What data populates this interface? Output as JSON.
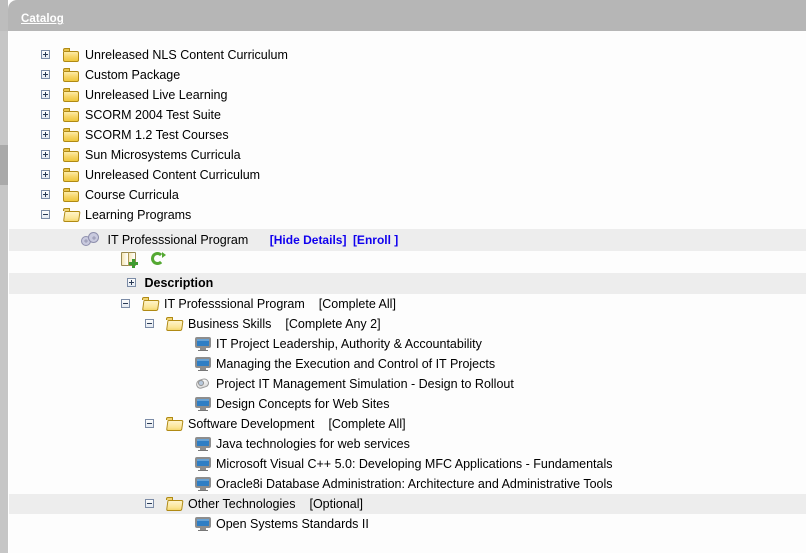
{
  "header": {
    "breadcrumb": "Catalog",
    "bar_color": "#b6b6b6"
  },
  "colors": {
    "link": "#1000ee",
    "band": "#ededed",
    "header": "#b6b6b6",
    "folder": "#f0cf5a",
    "monitor": "#2f7ec4"
  },
  "catalog": {
    "folders": [
      {
        "label": "Unreleased NLS Content Curriculum",
        "state": "collapsed",
        "icon": "folder-icon"
      },
      {
        "label": "Custom Package",
        "state": "collapsed",
        "icon": "folder-icon"
      },
      {
        "label": "Unreleased Live Learning",
        "state": "collapsed",
        "icon": "folder-icon"
      },
      {
        "label": "SCORM 2004 Test Suite",
        "state": "collapsed",
        "icon": "folder-icon"
      },
      {
        "label": "SCORM 1.2 Test Courses",
        "state": "collapsed",
        "icon": "folder-icon"
      },
      {
        "label": "Sun Microsystems Curricula",
        "state": "collapsed",
        "icon": "folder-icon"
      },
      {
        "label": "Unreleased Content Curriculum",
        "state": "collapsed",
        "icon": "folder-icon"
      },
      {
        "label": "Course Curricula",
        "state": "collapsed",
        "icon": "folder-icon"
      },
      {
        "label": "Learning Programs",
        "state": "expanded",
        "icon": "folder-open-icon"
      }
    ]
  },
  "program": {
    "title": "IT Professsional Program",
    "icon": "gears-icon",
    "hide_details_link": "[Hide Details]",
    "enroll_link": "[Enroll ]",
    "toolbar": {
      "add_to_folder": "add-to-folder-icon",
      "refresh": "refresh-icon"
    },
    "description_label": "Description",
    "description_state": "collapsed"
  },
  "structure": {
    "root": {
      "label": "IT Professsional Program",
      "rule": "[Complete All]",
      "state": "expanded"
    },
    "groups": [
      {
        "label": "Business Skills",
        "rule": "[Complete Any 2]",
        "state": "expanded",
        "banded": false,
        "items": [
          {
            "label": "IT Project Leadership, Authority & Accountability",
            "icon": "monitor-icon"
          },
          {
            "label": "Managing the Execution and Control of IT Projects",
            "icon": "monitor-icon"
          },
          {
            "label": "Project IT Management Simulation - Design to Rollout",
            "icon": "simulation-icon"
          },
          {
            "label": "Design Concepts for Web Sites",
            "icon": "monitor-icon"
          }
        ]
      },
      {
        "label": "Software Development",
        "rule": "[Complete All]",
        "state": "expanded",
        "banded": false,
        "items": [
          {
            "label": "Java technologies for web services",
            "icon": "monitor-icon"
          },
          {
            "label": "Microsoft Visual C++ 5.0: Developing MFC Applications - Fundamentals",
            "icon": "monitor-icon"
          },
          {
            "label": "Oracle8i Database Administration: Architecture and Administrative Tools",
            "icon": "monitor-icon"
          }
        ]
      },
      {
        "label": "Other Technologies",
        "rule": "[Optional]",
        "state": "expanded",
        "banded": true,
        "items": [
          {
            "label": "Open Systems Standards II",
            "icon": "monitor-icon"
          }
        ]
      }
    ]
  }
}
